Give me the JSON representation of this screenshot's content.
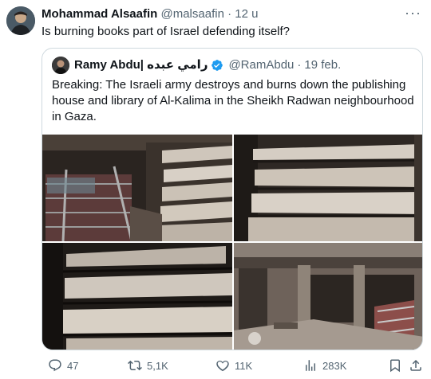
{
  "tweet": {
    "author_name": "Mohammad Alsaafin",
    "handle": "@malsaafin",
    "separator": "·",
    "time": "12 u",
    "text": "Is burning books part of Israel defending itself?",
    "more_label": "···"
  },
  "quote": {
    "author_name": "Ramy Abdu| رامي عبده",
    "handle": "@RamAbdu",
    "separator": "·",
    "date": "19 feb.",
    "text": "Breaking: The Israeli army destroys and burns down the publishing house and library of Al-Kalima in the Sheikh Radwan neighbourhood in Gaza.",
    "images": [
      "burned-library-photo-1",
      "burned-library-photo-2",
      "burned-library-photo-3",
      "burned-library-photo-4"
    ]
  },
  "actions": {
    "replies": "47",
    "reposts": "5,1K",
    "likes": "11K",
    "views": "283K"
  },
  "colors": {
    "text": "#0f1419",
    "muted": "#536471",
    "border": "#cfd9de",
    "verified": "#1d9bf0"
  }
}
